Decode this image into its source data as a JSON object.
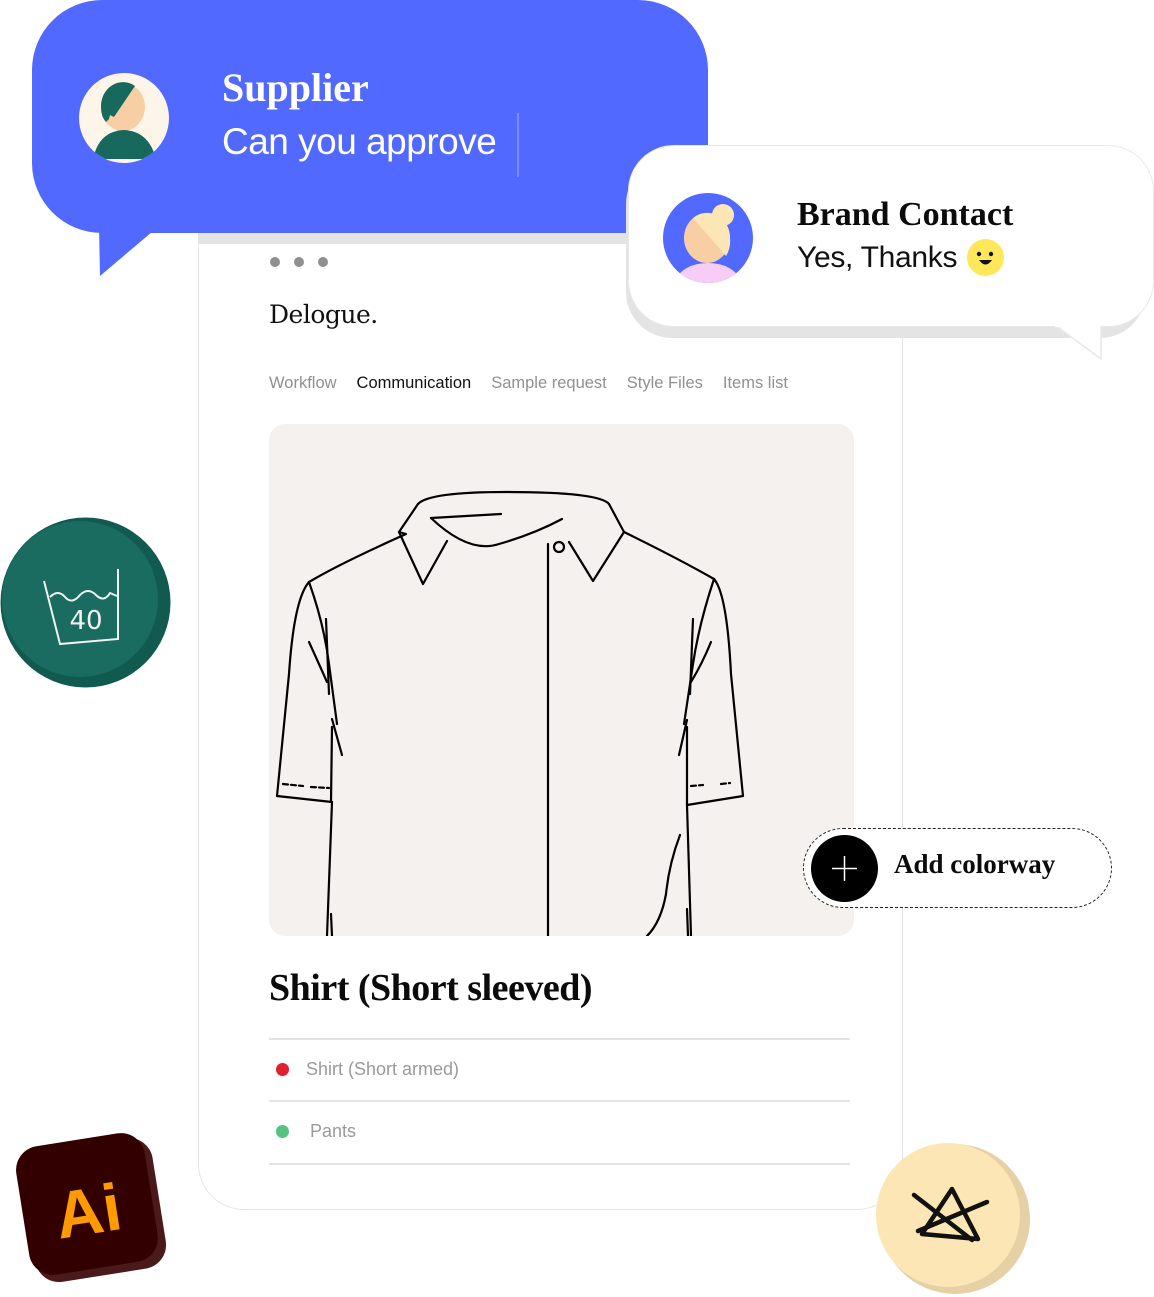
{
  "app": {
    "logo": "Delogue.",
    "tabs": [
      {
        "label": "Workflow",
        "active": false
      },
      {
        "label": "Communication",
        "active": true
      },
      {
        "label": "Sample request",
        "active": false
      },
      {
        "label": "Style Files",
        "active": false
      },
      {
        "label": "Items list",
        "active": false
      }
    ]
  },
  "product": {
    "title": "Shirt (Short sleeved)",
    "preview_icon": "shirt-sketch-icon",
    "items": [
      {
        "label": "Shirt (Short armed)",
        "status_color": "#e21f2e"
      },
      {
        "label": "Pants",
        "status_color": "#55c27f"
      }
    ]
  },
  "messages": {
    "supplier": {
      "name": "Supplier",
      "text": "Can you approve",
      "bubble_color": "#5169ff"
    },
    "brand_contact": {
      "name": "Brand Contact",
      "text": "Yes, Thanks",
      "emoji": "smiling-face-icon"
    }
  },
  "actions": {
    "add_colorway_label": "Add colorway"
  },
  "badges": {
    "wash": {
      "icon": "wash-40-icon",
      "label": "40",
      "color": "#1a6b60"
    },
    "bleach": {
      "icon": "do-not-bleach-icon",
      "color": "#fde6b5"
    },
    "illustrator": {
      "icon": "adobe-illustrator-icon",
      "label": "Ai",
      "color": "#330000",
      "accent": "#ff9a00"
    }
  }
}
